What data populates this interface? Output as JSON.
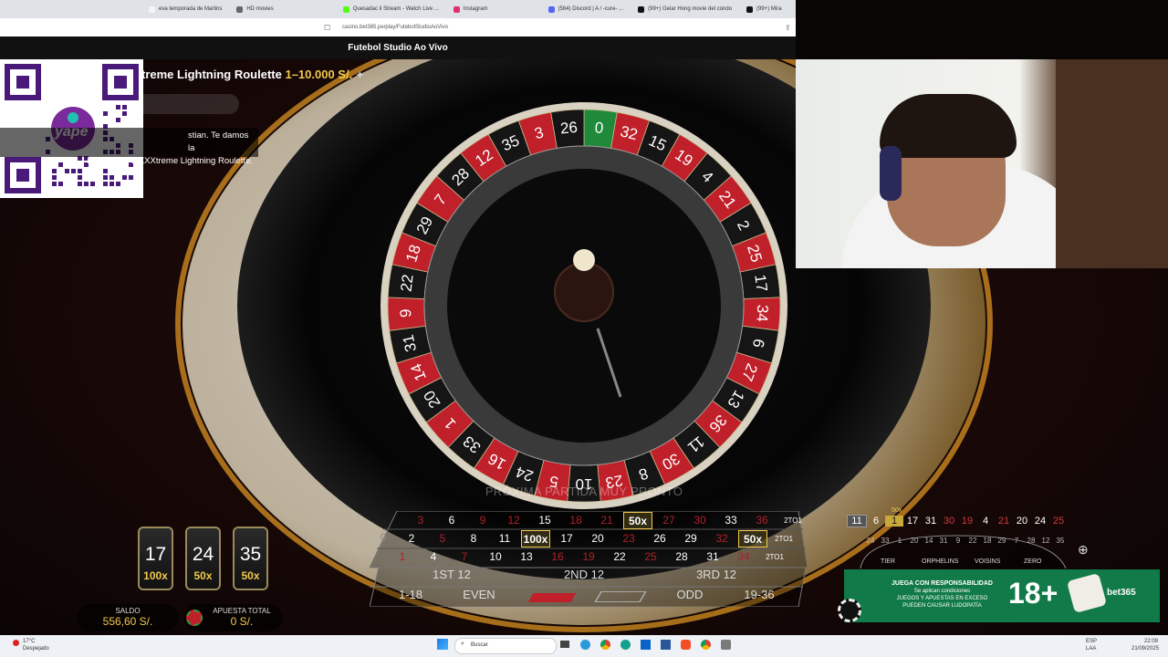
{
  "browser": {
    "tabs": [
      {
        "label": "eva temporada de Marlins",
        "color": "#f4f4f4"
      },
      {
        "label": "HD movies",
        "color": "#666"
      },
      {
        "label": "Quesadac il Stream - Watch Live ...",
        "color": "#53fc18"
      },
      {
        "label": "Instagram",
        "color": "#e1306c"
      },
      {
        "label": "(564) Discord | A / -cure- ...",
        "color": "#5865f2"
      },
      {
        "label": "(99+) Gelar Hong movie del condo",
        "color": "#111"
      },
      {
        "label": "(99+) Mira",
        "color": "#111"
      }
    ],
    "url": "casino.bet365.pe/play/FutebolStudioAoVivo",
    "game_header": "Futebol Studio Ao Vivo"
  },
  "game": {
    "title": "treme Lightning Roulette",
    "limits": "1–10.000 S/.",
    "welcome_line1": "stian. Te damos la",
    "welcome_line2": "bienvenida a XXXtreme Lightning Roulette.",
    "status": "PRÓXIMA PARTIDA MUY PRONTO",
    "wheel_numbers": [
      "0",
      "32",
      "15",
      "19",
      "4",
      "21",
      "2",
      "25",
      "17",
      "34",
      "6",
      "27",
      "13",
      "36",
      "11",
      "30",
      "8",
      "23",
      "10",
      "5",
      "24",
      "16",
      "33",
      "1",
      "20",
      "14",
      "31",
      "9",
      "22",
      "18",
      "29",
      "7",
      "28",
      "12",
      "35",
      "3",
      "26"
    ],
    "lucky_numbers": [
      {
        "number": "17",
        "multiplier": "100x"
      },
      {
        "number": "24",
        "multiplier": "50x"
      },
      {
        "number": "35",
        "multiplier": "50x"
      }
    ],
    "grid_rows": [
      [
        "3",
        "6",
        "9",
        "12",
        "15",
        "18",
        "21",
        "50x",
        "27",
        "30",
        "33",
        "36",
        "2TO1"
      ],
      [
        "2",
        "5",
        "8",
        "11",
        "100x",
        "17",
        "20",
        "23",
        "26",
        "29",
        "32",
        "50x",
        "2TO1"
      ],
      [
        "1",
        "4",
        "7",
        "10",
        "13",
        "16",
        "19",
        "22",
        "25",
        "28",
        "31",
        "34",
        "2TO1"
      ]
    ],
    "dozens": [
      "1ST 12",
      "2ND 12",
      "3RD 12"
    ],
    "outside": [
      "1-18",
      "EVEN",
      "",
      "",
      "ODD",
      "19-36"
    ],
    "zero": "0",
    "balance_label": "SALDO",
    "balance_value": "556,60 S/.",
    "total_bet_label": "APUESTA TOTAL",
    "total_bet_value": "0 S/.",
    "history": [
      "11",
      "6",
      "1",
      "17",
      "31",
      "30",
      "19",
      "4",
      "21",
      "20",
      "24",
      "25"
    ],
    "history_multiplier": "50x",
    "racetrack": [
      "TIER",
      "ORPHELINS",
      "VOISINS",
      "ZERO"
    ],
    "racetrack_nums": [
      "24",
      "33",
      "1",
      "20",
      "14",
      "31",
      "9",
      "22",
      "18",
      "29",
      "7",
      "28",
      "12",
      "35"
    ]
  },
  "promo": {
    "line1": "JUEGA CON RESPONSABILIDAD",
    "line2": "Se aplican condiciones",
    "line3": "JUEGOS Y APUESTAS EN EXCESO",
    "line4": "PUEDEN CAUSAR LUDOPATÍA",
    "age": "18+",
    "brand": "bet365"
  },
  "overlay": {
    "qr_brand": "yape"
  },
  "taskbar": {
    "weather_temp": "17°C",
    "weather_desc": "Despejado",
    "search_placeholder": "Buscar",
    "lang": "ESP",
    "lang2": "LAA",
    "time": "22:09",
    "date": "21/09/2025"
  }
}
